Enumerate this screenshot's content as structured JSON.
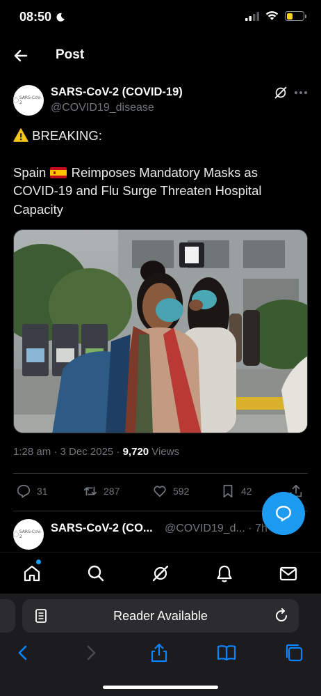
{
  "status": {
    "time": "08:50"
  },
  "header": {
    "title": "Post"
  },
  "post": {
    "author_name": "SARS-CoV-2 (COVID-19)",
    "author_handle": "@COVID19_disease",
    "avatar_text": "SARS-CoV-2",
    "line1": "BREAKING:",
    "body_before_flag": "Spain",
    "body_after_flag": "Reimposes Mandatory Masks as COVID-19 and Flu Surge Threaten Hospital Capacity",
    "meta_time": "1:28 am · 3 Dec 2025 · ",
    "views_count": "9,720",
    "views_label": " Views",
    "replies": "31",
    "reposts": "287",
    "likes": "592",
    "bookmarks": "42"
  },
  "reply": {
    "author_name": "SARS-CoV-2 (CO...",
    "author_handle": "@COVID19_d... · 7h",
    "avatar_text": "SARS-CoV-2"
  },
  "safari": {
    "address_text": "Reader Available"
  },
  "colors": {
    "accent": "#1d9bf0",
    "muted": "#71767b",
    "battery": "#f7d21a"
  }
}
